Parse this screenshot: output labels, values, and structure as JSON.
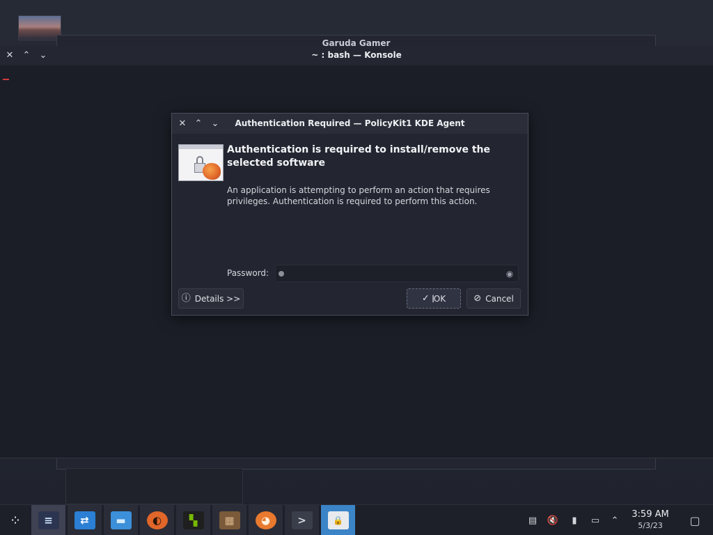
{
  "background_window": {
    "title": "Garuda Gamer"
  },
  "konsole": {
    "title": "~ : bash — Konsole",
    "buttons": {
      "close": "✕",
      "maximize": "⌃",
      "minimize": "⌄"
    }
  },
  "dialog": {
    "title": "Authentication Required — PolicyKit1 KDE Agent",
    "heading": "Authentication is required to install/remove the selected software",
    "message": "An application is attempting to perform an action that requires privileges. Authentication is required to perform this action.",
    "password_label": "Password:",
    "password_value": "",
    "details_label": "Details >>",
    "ok_label": "OK",
    "cancel_label": "Cancel",
    "icons": {
      "info": "ⓘ",
      "check": "✓",
      "cancel": "⊘",
      "eye": "◉",
      "text_cursor": "I"
    }
  },
  "taskbar": {
    "launcher_glyph": "⁘",
    "tasks": [
      {
        "name": "system-settings",
        "glyph": "≡",
        "color": "#2c3550",
        "fg": "#cfe3ff"
      },
      {
        "name": "discover",
        "glyph": "⇄",
        "color": "#2b7fd4",
        "fg": "#ffffff"
      },
      {
        "name": "file-manager",
        "glyph": "▬",
        "color": "#3c8fd9",
        "fg": "#d6ecff"
      },
      {
        "name": "garuda-gamer",
        "glyph": "◐",
        "color": "#e0662a",
        "fg": "#2a1408"
      },
      {
        "name": "nvidia",
        "glyph": "▚",
        "color": "#1f1f1f",
        "fg": "#76b900"
      },
      {
        "name": "minecraft",
        "glyph": "▦",
        "color": "#7a5a3a",
        "fg": "#d9b48a"
      },
      {
        "name": "garuda-eagle",
        "glyph": "◕",
        "color": "#e8792e",
        "fg": "#fff0dc"
      },
      {
        "name": "konsole",
        "glyph": ">",
        "color": "#3a3e4a",
        "fg": "#d6d8de"
      },
      {
        "name": "policykit",
        "glyph": "🔒",
        "color": "#e8eaee",
        "fg": "#5a5e68"
      }
    ],
    "tray": {
      "clipboard": "▤",
      "volume": "🔇",
      "battery": "▮",
      "network": "▭",
      "expand": "⌃",
      "show_desktop": "▢"
    },
    "clock_time": "3:59 AM",
    "clock_date": "5/3/23"
  }
}
